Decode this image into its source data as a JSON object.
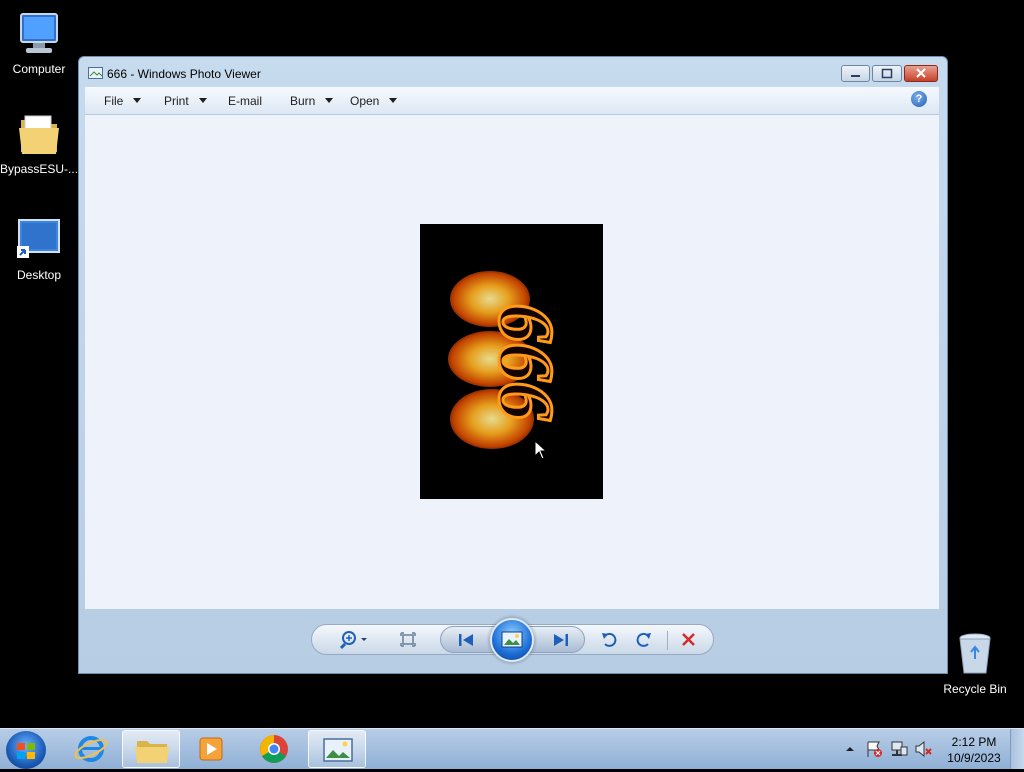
{
  "desktop": {
    "icons": [
      {
        "label": "Computer"
      },
      {
        "label": "BypassESU-..."
      },
      {
        "label": "Desktop"
      },
      {
        "label": "Recycle Bin"
      }
    ]
  },
  "window": {
    "title": "666 - Windows Photo Viewer",
    "menu": {
      "file": "File",
      "print": "Print",
      "email": "E-mail",
      "burn": "Burn",
      "open": "Open"
    },
    "help_symbol": "?",
    "photo_text": "666",
    "colors": {
      "accent": "#1f5fb8",
      "close": "#c7412b",
      "delete": "#d42a2a"
    }
  },
  "taskbar": {
    "time": "2:12 PM",
    "date": "10/9/2023"
  }
}
